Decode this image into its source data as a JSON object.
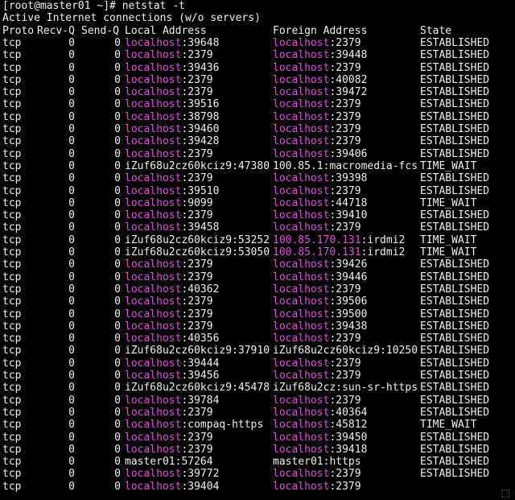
{
  "terminal": {
    "prompt": "[root@master01 ~]# netstat -t",
    "title": "Active Internet connections (w/o servers)",
    "headers": [
      "Proto",
      "Recv-Q",
      "Send-Q",
      "Local Address",
      "Foreign Address",
      "State"
    ],
    "header_line": "Proto Recv-Q Send-Q Local Address           Foreign Address         State",
    "colors": {
      "background": "#000000",
      "text": "#f0f0f0",
      "host_highlight": "#e14ee1"
    },
    "rows": [
      {
        "proto": "tcp",
        "recvq": "0",
        "sendq": "0",
        "local_host": "localhost",
        "local_port": ":39648",
        "local_hl": true,
        "foreign_host": "localhost",
        "foreign_port": ":2379",
        "foreign_hl": true,
        "state": "ESTABLISHED"
      },
      {
        "proto": "tcp",
        "recvq": "0",
        "sendq": "0",
        "local_host": "localhost",
        "local_port": ":2379",
        "local_hl": true,
        "foreign_host": "localhost",
        "foreign_port": ":39448",
        "foreign_hl": true,
        "state": "ESTABLISHED"
      },
      {
        "proto": "tcp",
        "recvq": "0",
        "sendq": "0",
        "local_host": "localhost",
        "local_port": ":39436",
        "local_hl": true,
        "foreign_host": "localhost",
        "foreign_port": ":2379",
        "foreign_hl": true,
        "state": "ESTABLISHED"
      },
      {
        "proto": "tcp",
        "recvq": "0",
        "sendq": "0",
        "local_host": "localhost",
        "local_port": ":2379",
        "local_hl": true,
        "foreign_host": "localhost",
        "foreign_port": ":40082",
        "foreign_hl": true,
        "state": "ESTABLISHED"
      },
      {
        "proto": "tcp",
        "recvq": "0",
        "sendq": "0",
        "local_host": "localhost",
        "local_port": ":2379",
        "local_hl": true,
        "foreign_host": "localhost",
        "foreign_port": ":39472",
        "foreign_hl": true,
        "state": "ESTABLISHED"
      },
      {
        "proto": "tcp",
        "recvq": "0",
        "sendq": "0",
        "local_host": "localhost",
        "local_port": ":39516",
        "local_hl": true,
        "foreign_host": "localhost",
        "foreign_port": ":2379",
        "foreign_hl": true,
        "state": "ESTABLISHED"
      },
      {
        "proto": "tcp",
        "recvq": "0",
        "sendq": "0",
        "local_host": "localhost",
        "local_port": ":38798",
        "local_hl": true,
        "foreign_host": "localhost",
        "foreign_port": ":2379",
        "foreign_hl": true,
        "state": "ESTABLISHED"
      },
      {
        "proto": "tcp",
        "recvq": "0",
        "sendq": "0",
        "local_host": "localhost",
        "local_port": ":39460",
        "local_hl": true,
        "foreign_host": "localhost",
        "foreign_port": ":2379",
        "foreign_hl": true,
        "state": "ESTABLISHED"
      },
      {
        "proto": "tcp",
        "recvq": "0",
        "sendq": "0",
        "local_host": "localhost",
        "local_port": ":39428",
        "local_hl": true,
        "foreign_host": "localhost",
        "foreign_port": ":2379",
        "foreign_hl": true,
        "state": "ESTABLISHED"
      },
      {
        "proto": "tcp",
        "recvq": "0",
        "sendq": "0",
        "local_host": "localhost",
        "local_port": ":2379",
        "local_hl": true,
        "foreign_host": "localhost",
        "foreign_port": ":39406",
        "foreign_hl": true,
        "state": "ESTABLISHED"
      },
      {
        "proto": "tcp",
        "recvq": "0",
        "sendq": "0",
        "local_host": "iZuf68u2cz60kciz9",
        "local_port": ":47380",
        "local_hl": false,
        "foreign_host": "100.85.1",
        "foreign_port": ":macromedia-fcs",
        "foreign_hl": false,
        "state": "TIME_WAIT"
      },
      {
        "proto": "tcp",
        "recvq": "0",
        "sendq": "0",
        "local_host": "localhost",
        "local_port": ":2379",
        "local_hl": true,
        "foreign_host": "localhost",
        "foreign_port": ":39398",
        "foreign_hl": true,
        "state": "ESTABLISHED"
      },
      {
        "proto": "tcp",
        "recvq": "0",
        "sendq": "0",
        "local_host": "localhost",
        "local_port": ":39510",
        "local_hl": true,
        "foreign_host": "localhost",
        "foreign_port": ":2379",
        "foreign_hl": true,
        "state": "ESTABLISHED"
      },
      {
        "proto": "tcp",
        "recvq": "0",
        "sendq": "0",
        "local_host": "localhost",
        "local_port": ":9099",
        "local_hl": true,
        "foreign_host": "localhost",
        "foreign_port": ":44718",
        "foreign_hl": true,
        "state": "TIME_WAIT"
      },
      {
        "proto": "tcp",
        "recvq": "0",
        "sendq": "0",
        "local_host": "localhost",
        "local_port": ":2379",
        "local_hl": true,
        "foreign_host": "localhost",
        "foreign_port": ":39410",
        "foreign_hl": true,
        "state": "ESTABLISHED"
      },
      {
        "proto": "tcp",
        "recvq": "0",
        "sendq": "0",
        "local_host": "localhost",
        "local_port": ":39458",
        "local_hl": true,
        "foreign_host": "localhost",
        "foreign_port": ":2379",
        "foreign_hl": true,
        "state": "ESTABLISHED"
      },
      {
        "proto": "tcp",
        "recvq": "0",
        "sendq": "0",
        "local_host": "iZuf68u2cz60kciz9",
        "local_port": ":53252",
        "local_hl": false,
        "foreign_host": "100.85.170.131",
        "foreign_port": ":irdmi2",
        "foreign_hl": true,
        "state": "TIME_WAIT"
      },
      {
        "proto": "tcp",
        "recvq": "0",
        "sendq": "0",
        "local_host": "iZuf68u2cz60kciz9",
        "local_port": ":53050",
        "local_hl": false,
        "foreign_host": "100.85.170.131",
        "foreign_port": ":irdmi2",
        "foreign_hl": true,
        "state": "TIME_WAIT"
      },
      {
        "proto": "tcp",
        "recvq": "0",
        "sendq": "0",
        "local_host": "localhost",
        "local_port": ":2379",
        "local_hl": true,
        "foreign_host": "localhost",
        "foreign_port": ":39426",
        "foreign_hl": true,
        "state": "ESTABLISHED"
      },
      {
        "proto": "tcp",
        "recvq": "0",
        "sendq": "0",
        "local_host": "localhost",
        "local_port": ":2379",
        "local_hl": true,
        "foreign_host": "localhost",
        "foreign_port": ":39446",
        "foreign_hl": true,
        "state": "ESTABLISHED"
      },
      {
        "proto": "tcp",
        "recvq": "0",
        "sendq": "0",
        "local_host": "localhost",
        "local_port": ":40362",
        "local_hl": true,
        "foreign_host": "localhost",
        "foreign_port": ":2379",
        "foreign_hl": true,
        "state": "ESTABLISHED"
      },
      {
        "proto": "tcp",
        "recvq": "0",
        "sendq": "0",
        "local_host": "localhost",
        "local_port": ":2379",
        "local_hl": true,
        "foreign_host": "localhost",
        "foreign_port": ":39506",
        "foreign_hl": true,
        "state": "ESTABLISHED"
      },
      {
        "proto": "tcp",
        "recvq": "0",
        "sendq": "0",
        "local_host": "localhost",
        "local_port": ":2379",
        "local_hl": true,
        "foreign_host": "localhost",
        "foreign_port": ":39500",
        "foreign_hl": true,
        "state": "ESTABLISHED"
      },
      {
        "proto": "tcp",
        "recvq": "0",
        "sendq": "0",
        "local_host": "localhost",
        "local_port": ":2379",
        "local_hl": true,
        "foreign_host": "localhost",
        "foreign_port": ":39438",
        "foreign_hl": true,
        "state": "ESTABLISHED"
      },
      {
        "proto": "tcp",
        "recvq": "0",
        "sendq": "0",
        "local_host": "localhost",
        "local_port": ":40356",
        "local_hl": true,
        "foreign_host": "localhost",
        "foreign_port": ":2379",
        "foreign_hl": true,
        "state": "ESTABLISHED"
      },
      {
        "proto": "tcp",
        "recvq": "0",
        "sendq": "0",
        "local_host": "iZuf68u2cz60kciz9",
        "local_port": ":37910",
        "local_hl": false,
        "foreign_host": "iZuf68u2cz60kciz9",
        "foreign_port": ":10250",
        "foreign_hl": false,
        "state": "ESTABLISHED"
      },
      {
        "proto": "tcp",
        "recvq": "0",
        "sendq": "0",
        "local_host": "localhost",
        "local_port": ":39444",
        "local_hl": true,
        "foreign_host": "localhost",
        "foreign_port": ":2379",
        "foreign_hl": true,
        "state": "ESTABLISHED"
      },
      {
        "proto": "tcp",
        "recvq": "0",
        "sendq": "0",
        "local_host": "localhost",
        "local_port": ":39456",
        "local_hl": true,
        "foreign_host": "localhost",
        "foreign_port": ":2379",
        "foreign_hl": true,
        "state": "ESTABLISHED"
      },
      {
        "proto": "tcp",
        "recvq": "0",
        "sendq": "0",
        "local_host": "iZuf68u2cz60kciz9",
        "local_port": ":45478",
        "local_hl": false,
        "foreign_host": "iZuf68u2cz",
        "foreign_port": ":sun-sr-https",
        "foreign_hl": false,
        "state": "ESTABLISHED"
      },
      {
        "proto": "tcp",
        "recvq": "0",
        "sendq": "0",
        "local_host": "localhost",
        "local_port": ":39784",
        "local_hl": true,
        "foreign_host": "localhost",
        "foreign_port": ":2379",
        "foreign_hl": true,
        "state": "ESTABLISHED"
      },
      {
        "proto": "tcp",
        "recvq": "0",
        "sendq": "0",
        "local_host": "localhost",
        "local_port": ":2379",
        "local_hl": true,
        "foreign_host": "localhost",
        "foreign_port": ":40364",
        "foreign_hl": true,
        "state": "ESTABLISHED"
      },
      {
        "proto": "tcp",
        "recvq": "0",
        "sendq": "0",
        "local_host": "localhost",
        "local_port": ":compaq-https",
        "local_hl": true,
        "foreign_host": "localhost",
        "foreign_port": ":45812",
        "foreign_hl": true,
        "state": "TIME_WAIT"
      },
      {
        "proto": "tcp",
        "recvq": "0",
        "sendq": "0",
        "local_host": "localhost",
        "local_port": ":2379",
        "local_hl": true,
        "foreign_host": "localhost",
        "foreign_port": ":39450",
        "foreign_hl": true,
        "state": "ESTABLISHED"
      },
      {
        "proto": "tcp",
        "recvq": "0",
        "sendq": "0",
        "local_host": "localhost",
        "local_port": ":2379",
        "local_hl": true,
        "foreign_host": "localhost",
        "foreign_port": ":39418",
        "foreign_hl": true,
        "state": "ESTABLISHED"
      },
      {
        "proto": "tcp",
        "recvq": "0",
        "sendq": "0",
        "local_host": "master01",
        "local_port": ":57264",
        "local_hl": false,
        "foreign_host": "master01",
        "foreign_port": ":https",
        "foreign_hl": false,
        "state": "ESTABLISHED"
      },
      {
        "proto": "tcp",
        "recvq": "0",
        "sendq": "0",
        "local_host": "localhost",
        "local_port": ":39772",
        "local_hl": true,
        "foreign_host": "localhost",
        "foreign_port": ":2379",
        "foreign_hl": true,
        "state": "ESTABLISHED"
      },
      {
        "proto": "tcp",
        "recvq": "0",
        "sendq": "0",
        "local_host": "localhost",
        "local_port": ":39404",
        "local_hl": true,
        "foreign_host": "localhost",
        "foreign_port": ":2379",
        "foreign_hl": true,
        "state": ""
      }
    ]
  }
}
